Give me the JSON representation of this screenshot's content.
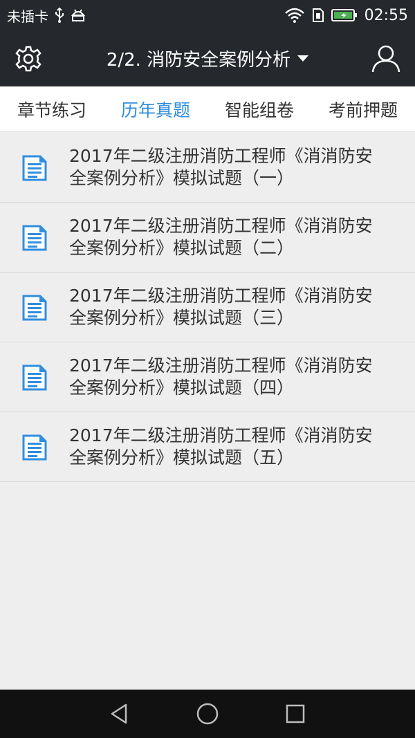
{
  "status_bar": {
    "carrier": "未插卡",
    "time": "02:55",
    "icons": [
      "usb-icon",
      "android-debug-icon",
      "wifi-icon",
      "sim-icon",
      "battery-charging-icon"
    ]
  },
  "app_bar": {
    "title": "2/2. 消防安全案例分析",
    "left_icon": "gear-icon",
    "right_icon": "user-icon"
  },
  "tabs": [
    {
      "label": "章节练习",
      "active": false
    },
    {
      "label": "历年真题",
      "active": true
    },
    {
      "label": "智能组卷",
      "active": false
    },
    {
      "label": "考前押题",
      "active": false
    }
  ],
  "papers": [
    {
      "line1": "2017年二级注册消防工程师《消消防安",
      "line2": "全案例分析》模拟试题（一）"
    },
    {
      "line1": "2017年二级注册消防工程师《消消防安",
      "line2": "全案例分析》模拟试题（二）"
    },
    {
      "line1": "2017年二级注册消防工程师《消消防安",
      "line2": "全案例分析》模拟试题（三）"
    },
    {
      "line1": "2017年二级注册消防工程师《消消防安",
      "line2": "全案例分析》模拟试题（四）"
    },
    {
      "line1": "2017年二级注册消防工程师《消消防安",
      "line2": "全案例分析》模拟试题（五）"
    }
  ],
  "colors": {
    "header_bg": "#25282c",
    "accent": "#2f8ede",
    "list_bg": "#eeeeee"
  },
  "nav_bar": {
    "icons": [
      "back-icon",
      "home-icon",
      "recents-icon"
    ]
  }
}
